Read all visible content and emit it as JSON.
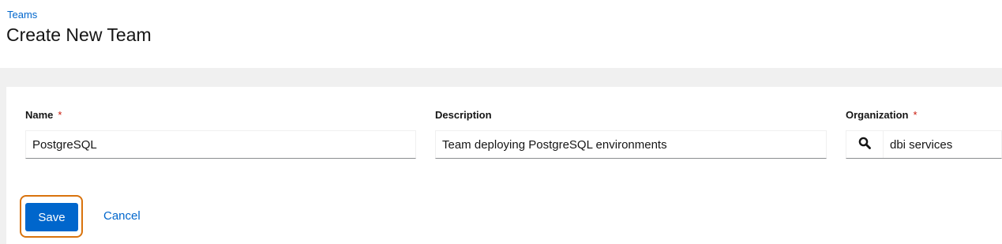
{
  "breadcrumb": {
    "label": "Teams"
  },
  "page": {
    "title": "Create New Team"
  },
  "form": {
    "name": {
      "label": "Name",
      "required_marker": "*",
      "value": "PostgreSQL"
    },
    "description": {
      "label": "Description",
      "value": "Team deploying PostgreSQL environments"
    },
    "organization": {
      "label": "Organization",
      "required_marker": "*",
      "value": "dbi services",
      "lookup_icon": "search-icon"
    }
  },
  "actions": {
    "save_label": "Save",
    "cancel_label": "Cancel"
  },
  "colors": {
    "link": "#0066cc",
    "primary_button": "#0066cc",
    "required": "#c9190b",
    "highlight_outline": "#d9730d",
    "background_band": "#f0f0f0"
  }
}
